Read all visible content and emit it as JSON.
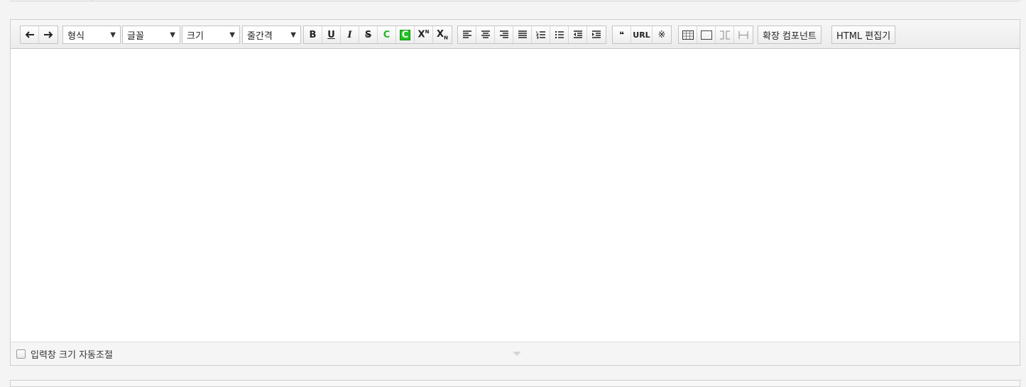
{
  "toolbar": {
    "undo_icon": "arrow-left-icon",
    "redo_icon": "arrow-right-icon",
    "dropdowns": [
      {
        "label": "형식"
      },
      {
        "label": "글꼴"
      },
      {
        "label": "크기"
      },
      {
        "label": "줄간격"
      }
    ],
    "dropdown_arrow": "▼",
    "format": {
      "bold": "B",
      "underline": "U",
      "italic": "I",
      "strike": "S",
      "color": "C",
      "bgcolor": "C",
      "superscript": "X",
      "superscript_mark": "N",
      "subscript": "X",
      "subscript_mark": "N"
    },
    "quote": "❝",
    "url": "URL",
    "special_char": "※",
    "extension": "확장 컴포넌트",
    "html_editor": "HTML 편집기"
  },
  "footer": {
    "autosize_label": "입력창 크기 자동조절",
    "autosize_checked": false
  },
  "colors": {
    "accent_green": "#1fc21f"
  }
}
